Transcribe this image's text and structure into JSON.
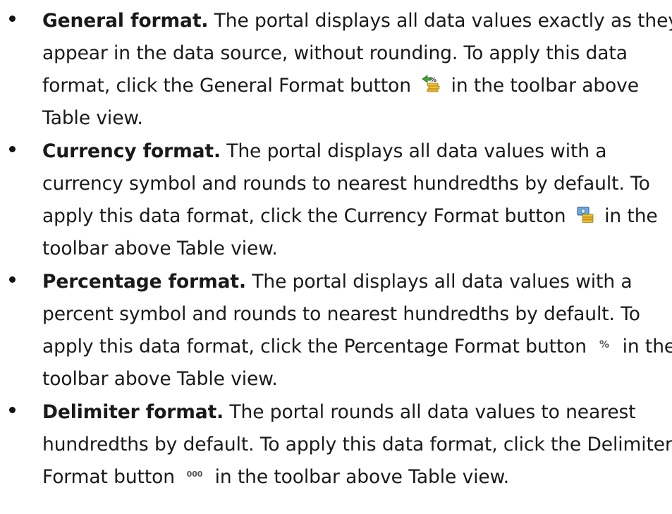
{
  "items": [
    {
      "heading": "General format.",
      "line1_rest": " The portal displays all data values exactly as they",
      "line2": "appear in the data source, without rounding. To apply this data",
      "line3_before": "format, click the General Format button",
      "line3_after": "in the toolbar above",
      "line4": "Table view.",
      "icon": "general-format-icon"
    },
    {
      "heading": "Currency format.",
      "line1_rest": " The portal displays all data values with a",
      "line2": "currency symbol and rounds to nearest hundredths by default. To",
      "line3_before": "apply this data format, click the Currency Format button",
      "line3_after": "in the",
      "line4": "toolbar above Table view.",
      "icon": "currency-format-icon"
    },
    {
      "heading": "Percentage format.",
      "line1_rest": " The portal displays all data values with a",
      "line2": "percent symbol and rounds to nearest hundredths by default. To",
      "line3_before": "apply this data format, click the Percentage Format button",
      "line3_after": "in the",
      "line4": "toolbar above Table view.",
      "icon": "percentage-format-icon",
      "icon_glyph": "%"
    },
    {
      "heading": "Delimiter format.",
      "line1_rest": " The portal rounds all data values to nearest",
      "line2": "hundredths by default. To apply this data format, click the Delimiter",
      "line3_before": "Format button",
      "line3_after": "in the toolbar above Table view.",
      "icon": "delimiter-format-icon",
      "icon_glyph": "000"
    }
  ]
}
